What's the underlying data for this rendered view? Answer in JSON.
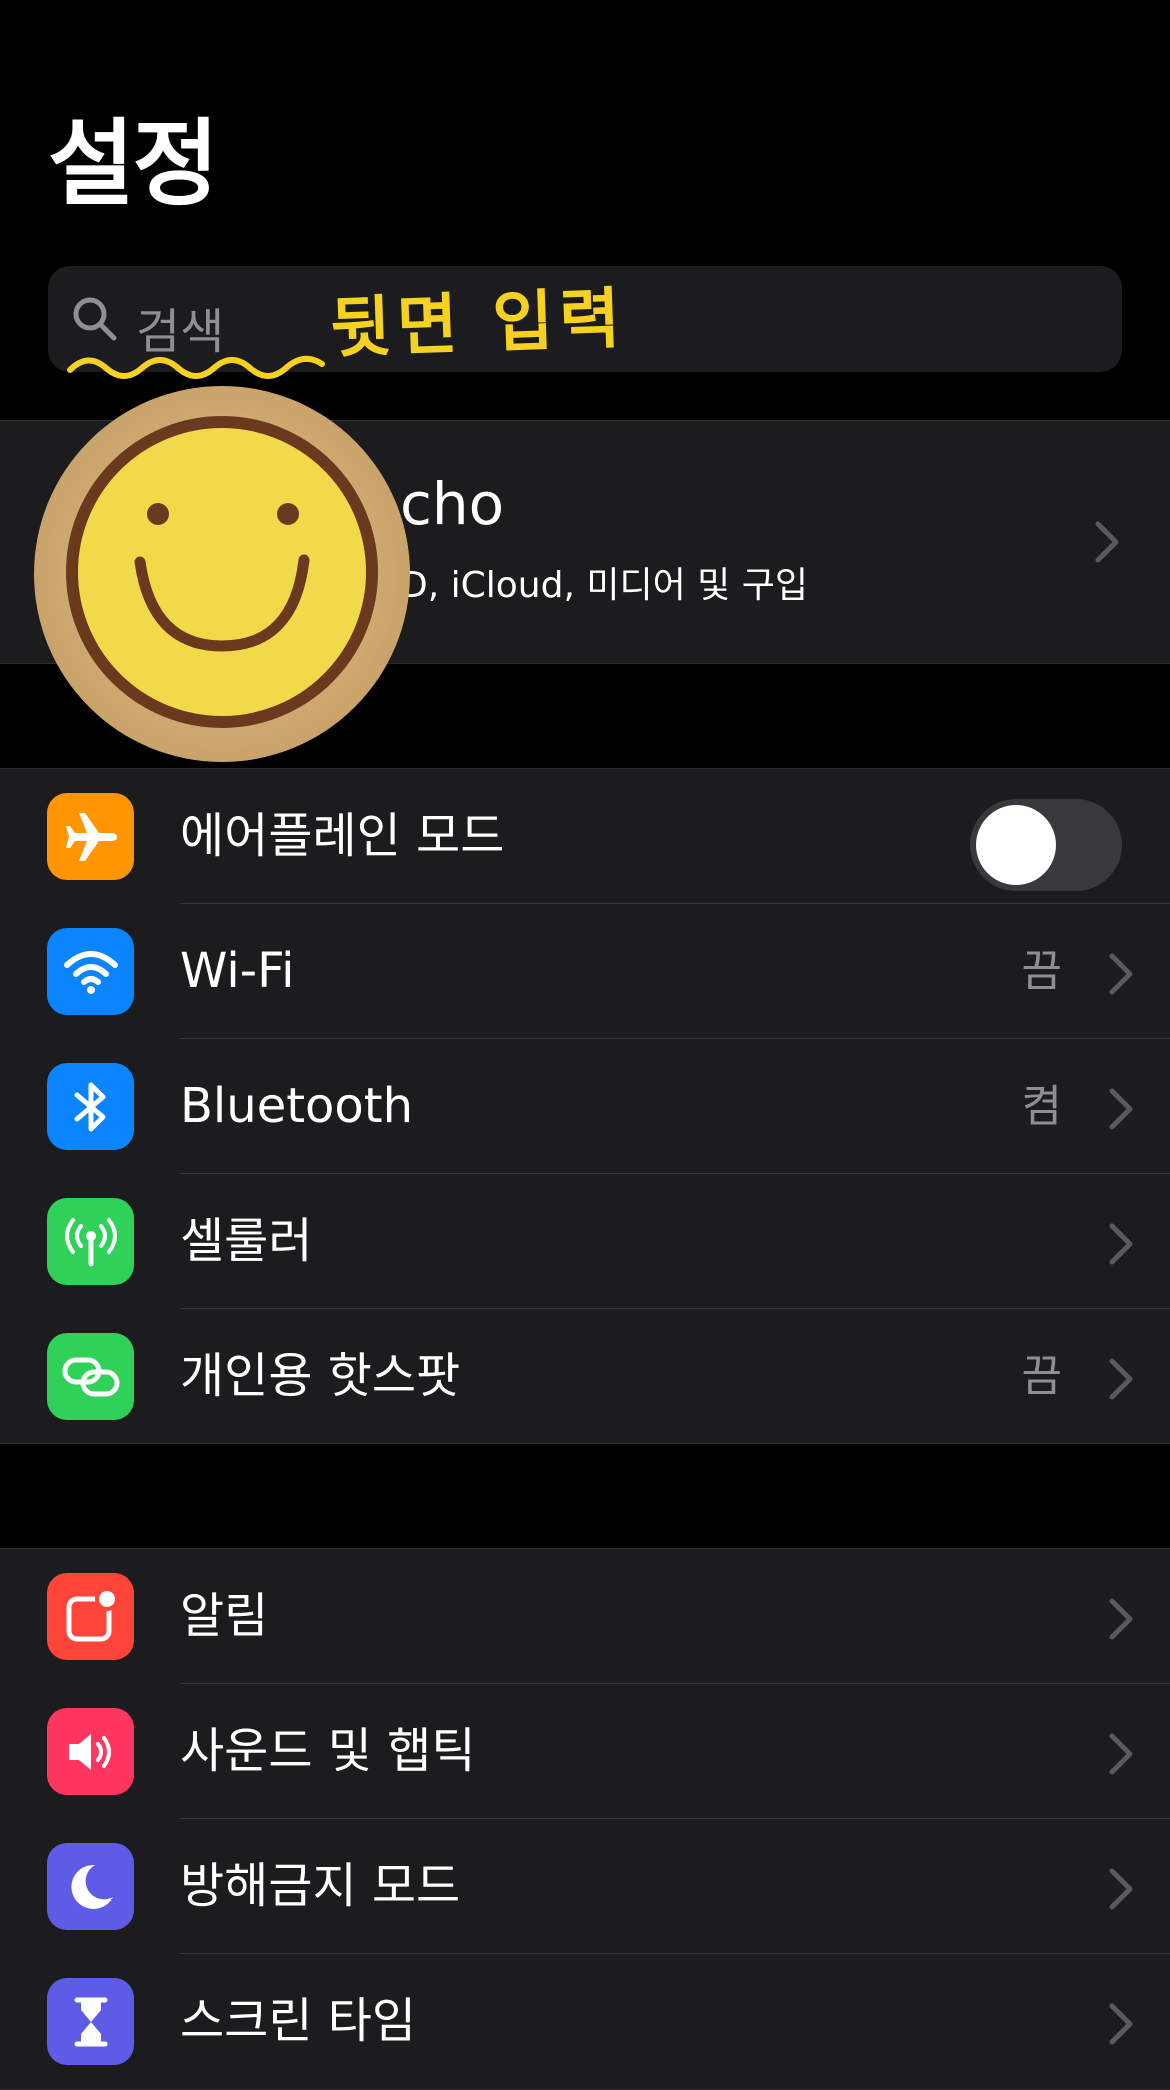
{
  "header": {
    "title": "설정"
  },
  "search": {
    "placeholder": "검색"
  },
  "annotation": {
    "text": "뒷면 입력"
  },
  "profile": {
    "name": "cho",
    "subtitle": "D, iCloud, 미디어 및 구입"
  },
  "group1": [
    {
      "label": "에어플레인 모드",
      "icon": "airplane-icon",
      "color": "#ff9500",
      "toggle": false
    },
    {
      "label": "Wi-Fi",
      "icon": "wifi-icon",
      "color": "#0a84ff",
      "value": "끔"
    },
    {
      "label": "Bluetooth",
      "icon": "bluetooth-icon",
      "color": "#0a84ff",
      "value": "켬"
    },
    {
      "label": "셀룰러",
      "icon": "antenna-icon",
      "color": "#30d158"
    },
    {
      "label": "개인용 핫스팟",
      "icon": "hotspot-link-icon",
      "color": "#30d158",
      "value": "끔"
    }
  ],
  "group2": [
    {
      "label": "알림",
      "icon": "notification-icon",
      "color": "#ff453a"
    },
    {
      "label": "사운드 및 햅틱",
      "icon": "speaker-icon",
      "color": "#ff375f"
    },
    {
      "label": "방해금지 모드",
      "icon": "moon-icon",
      "color": "#5e5ce6"
    },
    {
      "label": "스크린 타임",
      "icon": "hourglass-icon",
      "color": "#5e5ce6"
    }
  ]
}
